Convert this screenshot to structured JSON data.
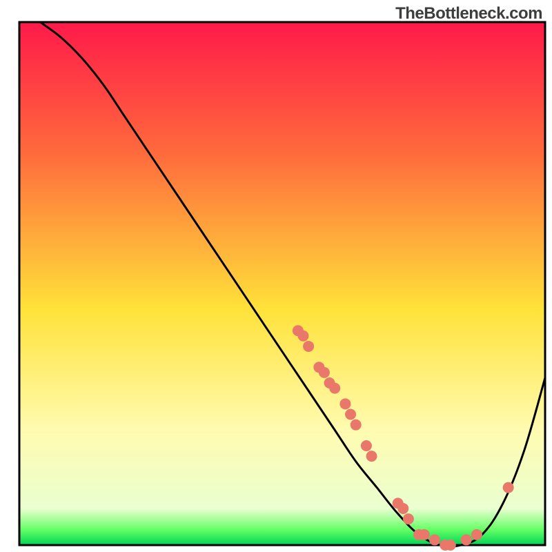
{
  "brand": "TheBottleneck.com",
  "chart_data": {
    "type": "line",
    "title": "",
    "xlabel": "",
    "ylabel": "",
    "xlim": [
      0,
      100
    ],
    "ylim": [
      0,
      100
    ],
    "grid": false,
    "gradient_stops": [
      {
        "offset": 0,
        "color": "#ff1a4a"
      },
      {
        "offset": 25,
        "color": "#ff6a3c"
      },
      {
        "offset": 55,
        "color": "#ffe23a"
      },
      {
        "offset": 78,
        "color": "#fffbb0"
      },
      {
        "offset": 93,
        "color": "#eaffd0"
      },
      {
        "offset": 97,
        "color": "#66ff66"
      },
      {
        "offset": 100,
        "color": "#00d455"
      }
    ],
    "series": [
      {
        "name": "bottleneck-curve",
        "color": "#000000",
        "x": [
          4,
          8,
          12,
          16,
          20,
          24,
          28,
          32,
          36,
          40,
          44,
          48,
          52,
          56,
          60,
          64,
          68,
          72,
          76,
          80,
          84,
          88,
          92,
          96,
          100
        ],
        "y": [
          100,
          97,
          93,
          88,
          82,
          76,
          70,
          64,
          58,
          52,
          46,
          40,
          34,
          28,
          22,
          16,
          11,
          6,
          2,
          0,
          0,
          2,
          8,
          18,
          32
        ]
      }
    ],
    "markers": {
      "name": "data-points",
      "color": "#e9786a",
      "radius": 8,
      "points": [
        {
          "x": 53,
          "y": 41
        },
        {
          "x": 54,
          "y": 40
        },
        {
          "x": 55,
          "y": 38
        },
        {
          "x": 57,
          "y": 34
        },
        {
          "x": 58,
          "y": 33
        },
        {
          "x": 59,
          "y": 31
        },
        {
          "x": 60,
          "y": 30
        },
        {
          "x": 62,
          "y": 27
        },
        {
          "x": 63,
          "y": 25
        },
        {
          "x": 64,
          "y": 23
        },
        {
          "x": 66,
          "y": 19
        },
        {
          "x": 67,
          "y": 17
        },
        {
          "x": 72,
          "y": 8
        },
        {
          "x": 73,
          "y": 7
        },
        {
          "x": 74,
          "y": 5
        },
        {
          "x": 76,
          "y": 2
        },
        {
          "x": 77,
          "y": 2
        },
        {
          "x": 79,
          "y": 1
        },
        {
          "x": 81,
          "y": 0
        },
        {
          "x": 82,
          "y": 0
        },
        {
          "x": 85,
          "y": 1
        },
        {
          "x": 87,
          "y": 2
        },
        {
          "x": 93,
          "y": 11
        }
      ]
    }
  }
}
